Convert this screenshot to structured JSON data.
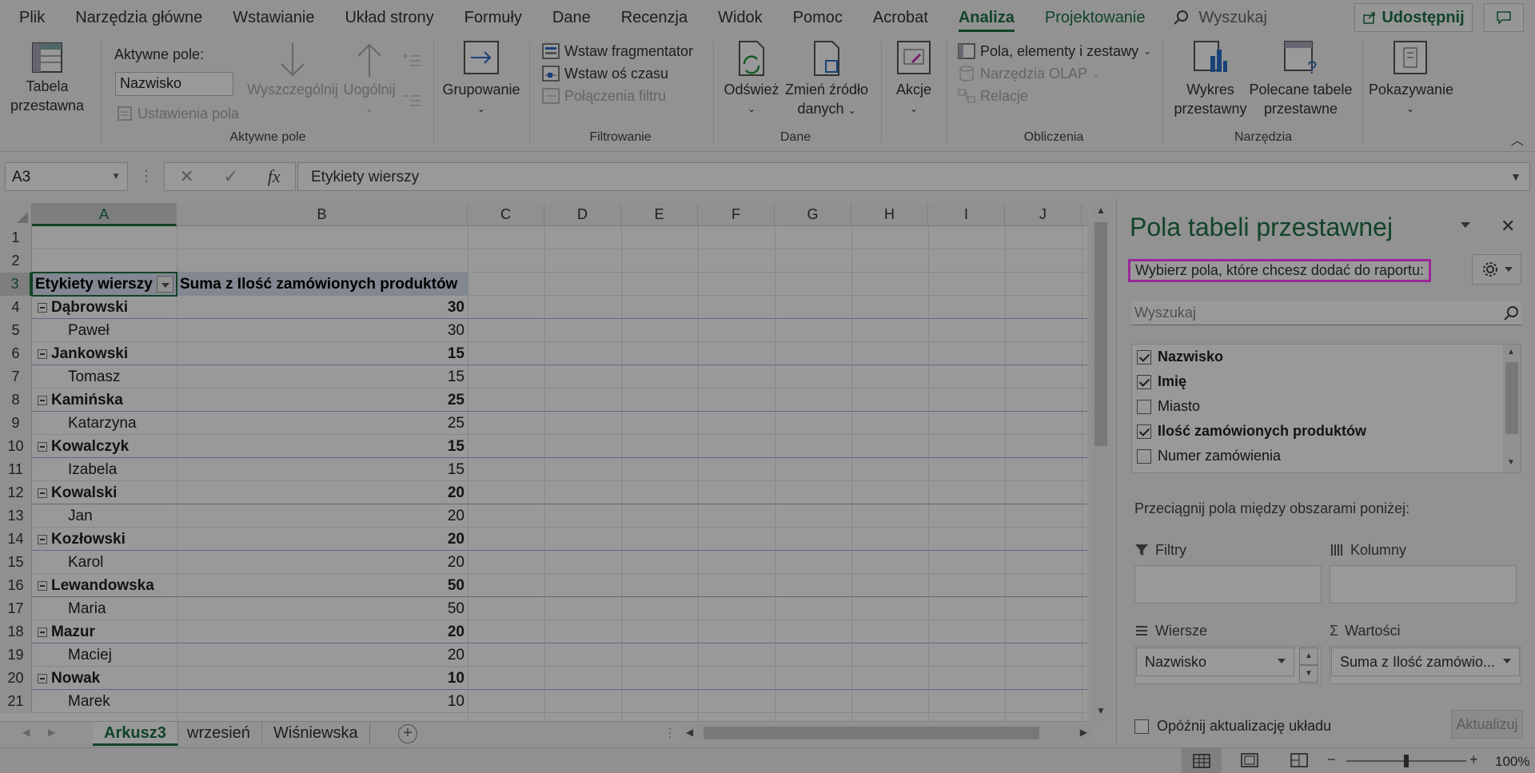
{
  "menu": {
    "items": [
      "Plik",
      "Narzędzia główne",
      "Wstawianie",
      "Układ strony",
      "Formuły",
      "Dane",
      "Recenzja",
      "Widok",
      "Pomoc",
      "Acrobat",
      "Analiza",
      "Projektowanie"
    ],
    "active": "Analiza",
    "search_label": "Wyszukaj",
    "share_label": "Udostępnij"
  },
  "ribbon": {
    "pivot_table": "Tabela",
    "pivot_table2": "przestawna",
    "active_field_label": "Aktywne pole:",
    "active_field_value": "Nazwisko",
    "field_settings": "Ustawienia pola",
    "drill_down": "Wyszczególnij",
    "drill_up": "Uogólnij",
    "group_active_field": "Aktywne pole",
    "grouping": "Grupowanie",
    "insert_slicer": "Wstaw fragmentator",
    "insert_timeline": "Wstaw oś czasu",
    "filter_connections": "Połączenia filtru",
    "group_filter": "Filtrowanie",
    "refresh": "Odśwież",
    "change_source1": "Zmień źródło",
    "change_source2": "danych",
    "group_data": "Dane",
    "actions": "Akcje",
    "fields_items_sets": "Pola, elementy i zestawy",
    "olap_tools": "Narzędzia OLAP",
    "relations": "Relacje",
    "group_calc": "Obliczenia",
    "pivot_chart1": "Wykres",
    "pivot_chart2": "przestawny",
    "recommended1": "Polecane tabele",
    "recommended2": "przestawne",
    "group_tools": "Narzędzia",
    "show": "Pokazywanie"
  },
  "formula_bar": {
    "name_box": "A3",
    "content": "Etykiety wierszy"
  },
  "grid": {
    "columns": [
      "A",
      "B",
      "C",
      "D",
      "E",
      "F",
      "G",
      "H",
      "I",
      "J"
    ],
    "row_numbers": [
      "1",
      "2",
      "3",
      "4",
      "5",
      "6",
      "7",
      "8",
      "9",
      "10",
      "11",
      "12",
      "13",
      "14",
      "15",
      "16",
      "17",
      "18",
      "19",
      "20",
      "21"
    ],
    "header_a": "Etykiety wierszy",
    "header_b": "Suma z Ilość zamówionych produktów",
    "rows": [
      {
        "label": "Dąbrowski",
        "value": "30",
        "group": true
      },
      {
        "label": "Paweł",
        "value": "30",
        "group": false
      },
      {
        "label": "Jankowski",
        "value": "15",
        "group": true
      },
      {
        "label": "Tomasz",
        "value": "15",
        "group": false
      },
      {
        "label": "Kamińska",
        "value": "25",
        "group": true
      },
      {
        "label": "Katarzyna",
        "value": "25",
        "group": false
      },
      {
        "label": "Kowalczyk",
        "value": "15",
        "group": true
      },
      {
        "label": "Izabela",
        "value": "15",
        "group": false
      },
      {
        "label": "Kowalski",
        "value": "20",
        "group": true
      },
      {
        "label": "Jan",
        "value": "20",
        "group": false
      },
      {
        "label": "Kozłowski",
        "value": "20",
        "group": true
      },
      {
        "label": "Karol",
        "value": "20",
        "group": false
      },
      {
        "label": "Lewandowska",
        "value": "50",
        "group": true
      },
      {
        "label": "Maria",
        "value": "50",
        "group": false
      },
      {
        "label": "Mazur",
        "value": "20",
        "group": true
      },
      {
        "label": "Maciej",
        "value": "20",
        "group": false
      },
      {
        "label": "Nowak",
        "value": "10",
        "group": true
      },
      {
        "label": "Marek",
        "value": "10",
        "group": false
      }
    ]
  },
  "sheets": {
    "tabs": [
      "Arkusz3",
      "wrzesień",
      "Wiśniewska"
    ],
    "active": "Arkusz3"
  },
  "status": {
    "zoom": "100%"
  },
  "pane": {
    "title": "Pola tabeli przestawnej",
    "hint": "Wybierz pola, które chcesz dodać do raportu:",
    "search_placeholder": "Wyszukaj",
    "fields": [
      {
        "label": "Nazwisko",
        "checked": true
      },
      {
        "label": "Imię",
        "checked": true
      },
      {
        "label": "Miasto",
        "checked": false
      },
      {
        "label": "Ilość zamówionych produktów",
        "checked": true
      },
      {
        "label": "Numer zamówienia",
        "checked": false
      }
    ],
    "drag_hint": "Przeciągnij pola między obszarami poniżej:",
    "filters": "Filtry",
    "columns": "Kolumny",
    "rows": "Wiersze",
    "values": "Wartości",
    "rows_field": "Nazwisko",
    "values_field": "Suma z Ilość zamówio...",
    "defer": "Opóźnij aktualizację układu",
    "update": "Aktualizuj"
  }
}
